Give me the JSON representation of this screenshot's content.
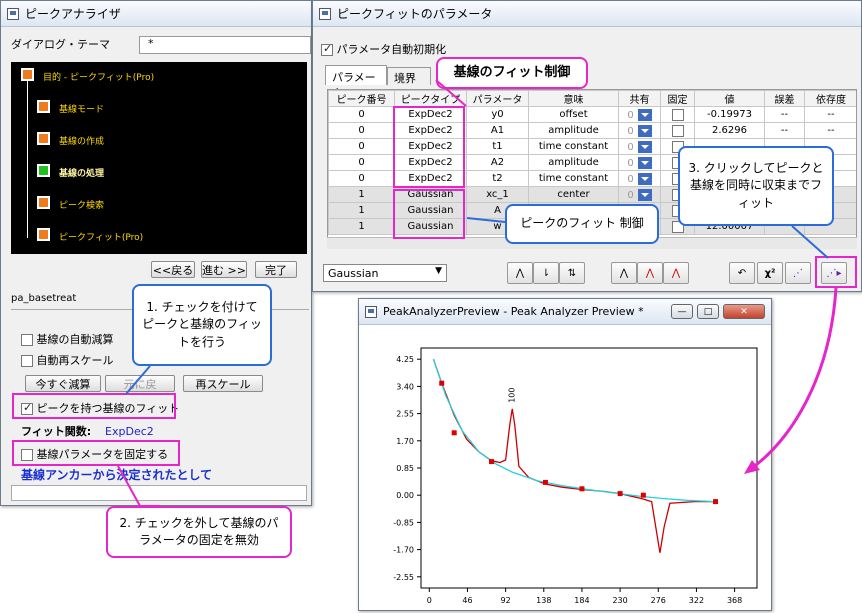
{
  "analyzer": {
    "title": "ピークアナライザ",
    "theme_label": "ダイアログ・テーマ",
    "theme_value": "*",
    "tree": [
      "目的 - ピークフィット(Pro)",
      "基線モード",
      "基線の作成",
      "基線の処理",
      "ピーク検索",
      "ピークフィット(Pro)"
    ],
    "back": "<<戻る",
    "next": "進む >>",
    "finish": "完了",
    "page_name": "pa_basetreat",
    "auto_subtract": "基線の自動減算",
    "auto_rescale": "自動再スケール",
    "subtract_now": "今すぐ減算",
    "undo": "元に戻",
    "rescale": "再スケール",
    "fit_with_peaks": "ピークを持つ基線のフィット",
    "fit_func_label": "フィット関数:",
    "fit_func_value": "ExpDec2",
    "fix_params": "基線パラメータを固定する",
    "anchor_text": "基線アンカーから決定されたとして"
  },
  "params": {
    "title": "ピークフィットのパラメータ",
    "auto_init": "パラメータ自動初期化",
    "tabs": [
      "パラメータ",
      "境界"
    ],
    "columns": [
      "ピーク番号",
      "ピークタイプ",
      "パラメータ",
      "意味",
      "共有",
      "固定",
      "値",
      "誤差",
      "依存度"
    ],
    "rows": [
      {
        "n": "0",
        "type": "ExpDec2",
        "p": "y0",
        "m": "offset",
        "s": "0",
        "v": "-0.19973",
        "e": "--",
        "d": "--"
      },
      {
        "n": "0",
        "type": "ExpDec2",
        "p": "A1",
        "m": "amplitude",
        "s": "0",
        "v": "2.6296",
        "e": "--",
        "d": "--"
      },
      {
        "n": "0",
        "type": "ExpDec2",
        "p": "t1",
        "m": "time constant",
        "s": "0",
        "v": "",
        "e": "",
        "d": ""
      },
      {
        "n": "0",
        "type": "ExpDec2",
        "p": "A2",
        "m": "amplitude",
        "s": "0",
        "v": "",
        "e": "",
        "d": ""
      },
      {
        "n": "0",
        "type": "ExpDec2",
        "p": "t2",
        "m": "time constant",
        "s": "0",
        "v": "",
        "e": "",
        "d": ""
      },
      {
        "n": "1",
        "type": "Gaussian",
        "p": "xc_1",
        "m": "center",
        "s": "0",
        "v": "",
        "e": "",
        "d": ""
      },
      {
        "n": "1",
        "type": "Gaussian",
        "p": "A",
        "m": "",
        "s": "",
        "v": "",
        "e": "",
        "d": ""
      },
      {
        "n": "1",
        "type": "Gaussian",
        "p": "w",
        "m": "",
        "s": "",
        "v": "12.00007",
        "e": "",
        "d": ""
      }
    ],
    "func_select": "Gaussian"
  },
  "preview": {
    "title": "PeakAnalyzerPreview - Peak Analyzer Preview *"
  },
  "callouts": {
    "baseline_ctrl": "基線のフィット制御",
    "peak_ctrl": "ピークのフィット 制御",
    "step3": "3. クリックしてピークと基線を同時に収束までフィット",
    "step1": "1. チェックを付けてピークと基線のフィットを行う",
    "step2": "2. チェックを外して基線のパラメータの固定を無効"
  },
  "chart_data": {
    "type": "line",
    "x_ticks": [
      "0",
      "46",
      "92",
      "138",
      "184",
      "230",
      "276",
      "322",
      "368"
    ],
    "y_ticks": [
      "4.25",
      "3.40",
      "2.55",
      "1.70",
      "0.85",
      "0.00",
      "-0.85",
      "-1.70",
      "-2.55"
    ],
    "xlim": [
      -10,
      395
    ],
    "ylim": [
      -2.9,
      4.6
    ],
    "peak_label": "100",
    "series": [
      {
        "values": [
          [
            5,
            4.25
          ],
          [
            15,
            3.5
          ],
          [
            30,
            2.5
          ],
          [
            45,
            1.75
          ],
          [
            60,
            1.35
          ],
          [
            75,
            1.08
          ],
          [
            85,
            1.02
          ],
          [
            92,
            1.1
          ],
          [
            97,
            2.2
          ],
          [
            100,
            2.7
          ],
          [
            103,
            2.2
          ],
          [
            108,
            0.9
          ],
          [
            120,
            0.55
          ],
          [
            140,
            0.35
          ],
          [
            160,
            0.25
          ],
          [
            184,
            0.18
          ],
          [
            210,
            0.12
          ],
          [
            230,
            0.05
          ],
          [
            255,
            -0.1
          ],
          [
            268,
            -0.2
          ],
          [
            273,
            -1.0
          ],
          [
            278,
            -1.8
          ],
          [
            283,
            -1.0
          ],
          [
            290,
            -0.25
          ],
          [
            320,
            -0.2
          ],
          [
            345,
            -0.2
          ]
        ],
        "color": "#cc0000"
      },
      {
        "values": [
          [
            5,
            4.25
          ],
          [
            20,
            3.1
          ],
          [
            40,
            2.0
          ],
          [
            60,
            1.35
          ],
          [
            80,
            0.98
          ],
          [
            100,
            0.72
          ],
          [
            130,
            0.45
          ],
          [
            160,
            0.3
          ],
          [
            190,
            0.18
          ],
          [
            220,
            0.08
          ],
          [
            250,
            -0.02
          ],
          [
            280,
            -0.1
          ],
          [
            310,
            -0.16
          ],
          [
            345,
            -0.2
          ]
        ],
        "color": "#22d4e0"
      }
    ],
    "anchors": [
      [
        15,
        3.5
      ],
      [
        30,
        1.95
      ],
      [
        75,
        1.05
      ],
      [
        140,
        0.4
      ],
      [
        184,
        0.2
      ],
      [
        230,
        0.05
      ],
      [
        258,
        0.0
      ],
      [
        345,
        -0.2
      ]
    ]
  }
}
